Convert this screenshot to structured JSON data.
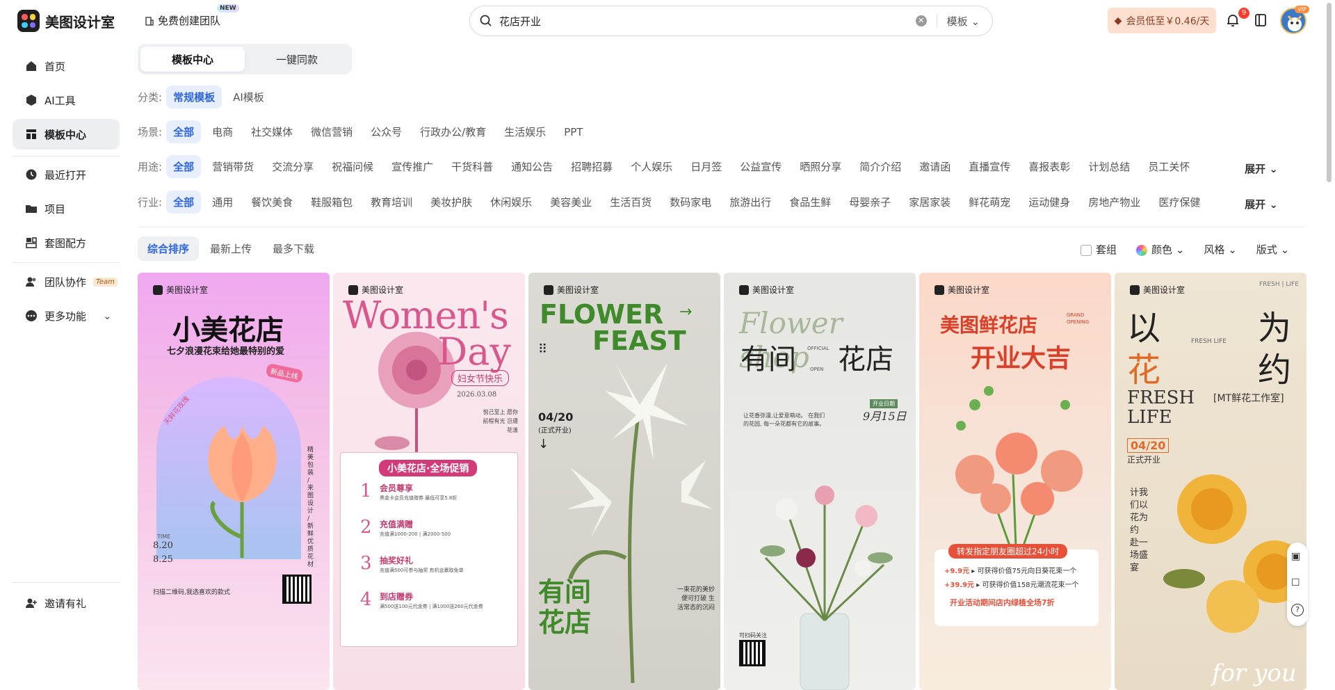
{
  "app": {
    "name": "美图设计室"
  },
  "header": {
    "team_button": "免费创建团队",
    "team_badge": "NEW",
    "search_value": "花店开业",
    "search_type": "模板",
    "vip_button": "会员低至￥0.46/天",
    "notification_count": "9",
    "avatar_badge": "VIP"
  },
  "sidebar": {
    "items": [
      {
        "label": "首页"
      },
      {
        "label": "AI工具"
      },
      {
        "label": "模板中心"
      },
      {
        "label": "最近打开"
      },
      {
        "label": "项目"
      },
      {
        "label": "套图配方"
      },
      {
        "label": "团队协作"
      },
      {
        "label": "更多功能"
      },
      {
        "label": "邀请有礼"
      }
    ],
    "team_tag": "Team"
  },
  "tabs": {
    "template_center": "模板中心",
    "one_click": "一键同款"
  },
  "filters": {
    "category": {
      "label": "分类:",
      "options": [
        "常规模板",
        "AI模板"
      ]
    },
    "scene": {
      "label": "场景:",
      "options": [
        "全部",
        "电商",
        "社交媒体",
        "微信营销",
        "公众号",
        "行政办公/教育",
        "生活娱乐",
        "PPT"
      ]
    },
    "usage": {
      "label": "用途:",
      "options": [
        "全部",
        "营销带货",
        "交流分享",
        "祝福问候",
        "宣传推广",
        "干货科普",
        "通知公告",
        "招聘招募",
        "个人娱乐",
        "日月签",
        "公益宣传",
        "晒照分享",
        "简介介绍",
        "邀请函",
        "直播宣传",
        "喜报表彰",
        "计划总结",
        "员工关怀"
      ]
    },
    "industry": {
      "label": "行业:",
      "options": [
        "全部",
        "通用",
        "餐饮美食",
        "鞋服箱包",
        "教育培训",
        "美妆护肤",
        "休闲娱乐",
        "美容美业",
        "生活百货",
        "数码家电",
        "旅游出行",
        "食品生鲜",
        "母婴亲子",
        "家居家装",
        "鲜花萌宠",
        "运动健身",
        "房地产物业",
        "医疗保健"
      ]
    },
    "expand": "展开"
  },
  "sort": {
    "options": [
      "综合排序",
      "最新上传",
      "最多下载"
    ],
    "group": "套组",
    "color": "颜色",
    "style": "风格",
    "layout": "版式"
  },
  "cards": [
    {
      "brand": "美图设计室",
      "title": "小美花店",
      "subtitle": "七夕浪漫花束给她最特别的爱",
      "tag": "新品上线",
      "arc": "天鲜花玫瑰",
      "side": "精美包装 / 来图设计 / 新鲜优质花材",
      "time_label": "TIME",
      "date1": "8.20",
      "date2": "8.25",
      "footer": "扫描二维码,我选喜欢的款式"
    },
    {
      "brand": "美图设计室",
      "title1": "Women's",
      "title2": "Day",
      "pill": "妇女节快乐",
      "date": "2026.03.08",
      "note": "悦己至上 愿你前程有光 岂遵花漾",
      "promo": "小美花店·全场促销",
      "items": [
        {
          "n": "1",
          "t": "会员尊享",
          "d": "黑金卡会员充值赠券 最低可享5.8折"
        },
        {
          "n": "2",
          "t": "充值满赠",
          "d": "充值满1000-200 | 满2000-500"
        },
        {
          "n": "3",
          "t": "抽奖好礼",
          "d": "充值满500可参与抽奖 有机会赢取免单"
        },
        {
          "n": "4",
          "t": "到店赠券",
          "d": "满500送100元代金券 | 满1000送260元代金券"
        }
      ]
    },
    {
      "brand": "美图设计室",
      "title1": "FLOWER",
      "title2": "FEAST",
      "date": "04/20",
      "sub": "(正式开业)",
      "bottom1": "有间",
      "bottom2": "花店",
      "note": "一束花的美妙 便可打破 生活常态的沉闷"
    },
    {
      "brand": "美图设计室",
      "script": "Flower shop",
      "title1": "有间",
      "title2": "花店",
      "official": "OFFICIAL",
      "open": "OPEN",
      "date": "9月15日",
      "date_tag": "开业日期",
      "intro": "让花香弥漫,让爱意萌动。 在我们的花园, 每一朵花都有它的故事。",
      "scan": "可扫码关注"
    },
    {
      "brand": "美图设计室",
      "title1": "美图鲜花店",
      "grand": "GRAND OPENING",
      "title2": "开业大吉",
      "banner": "转发指定朋友圈超过24小时",
      "row1_price": "+9.9元",
      "row1_text": "可获得价值75元向日葵花束一个",
      "row2_price": "+39.9元",
      "row2_text": "可获得价值158元潮流花束一个",
      "footer": "开业活动期间店内绿植全场7折"
    },
    {
      "brand": "美图设计室",
      "corner": "FRESH | LIFE",
      "c1": "以",
      "c2": "为",
      "c3": "花",
      "c4": "约",
      "mid": "FRESH LIFE",
      "en1": "FRESH",
      "en2": "LIFE",
      "shop": "[MT鲜花工作室]",
      "date": "04/20",
      "open": "正式开业",
      "vertical": "计我们以花为约 赴一场盛宴",
      "script": "for you"
    }
  ],
  "colors": {
    "accent": "#2f66e0",
    "chip_bg": "#e7efff",
    "vip_bg": "#ffe0d0"
  }
}
